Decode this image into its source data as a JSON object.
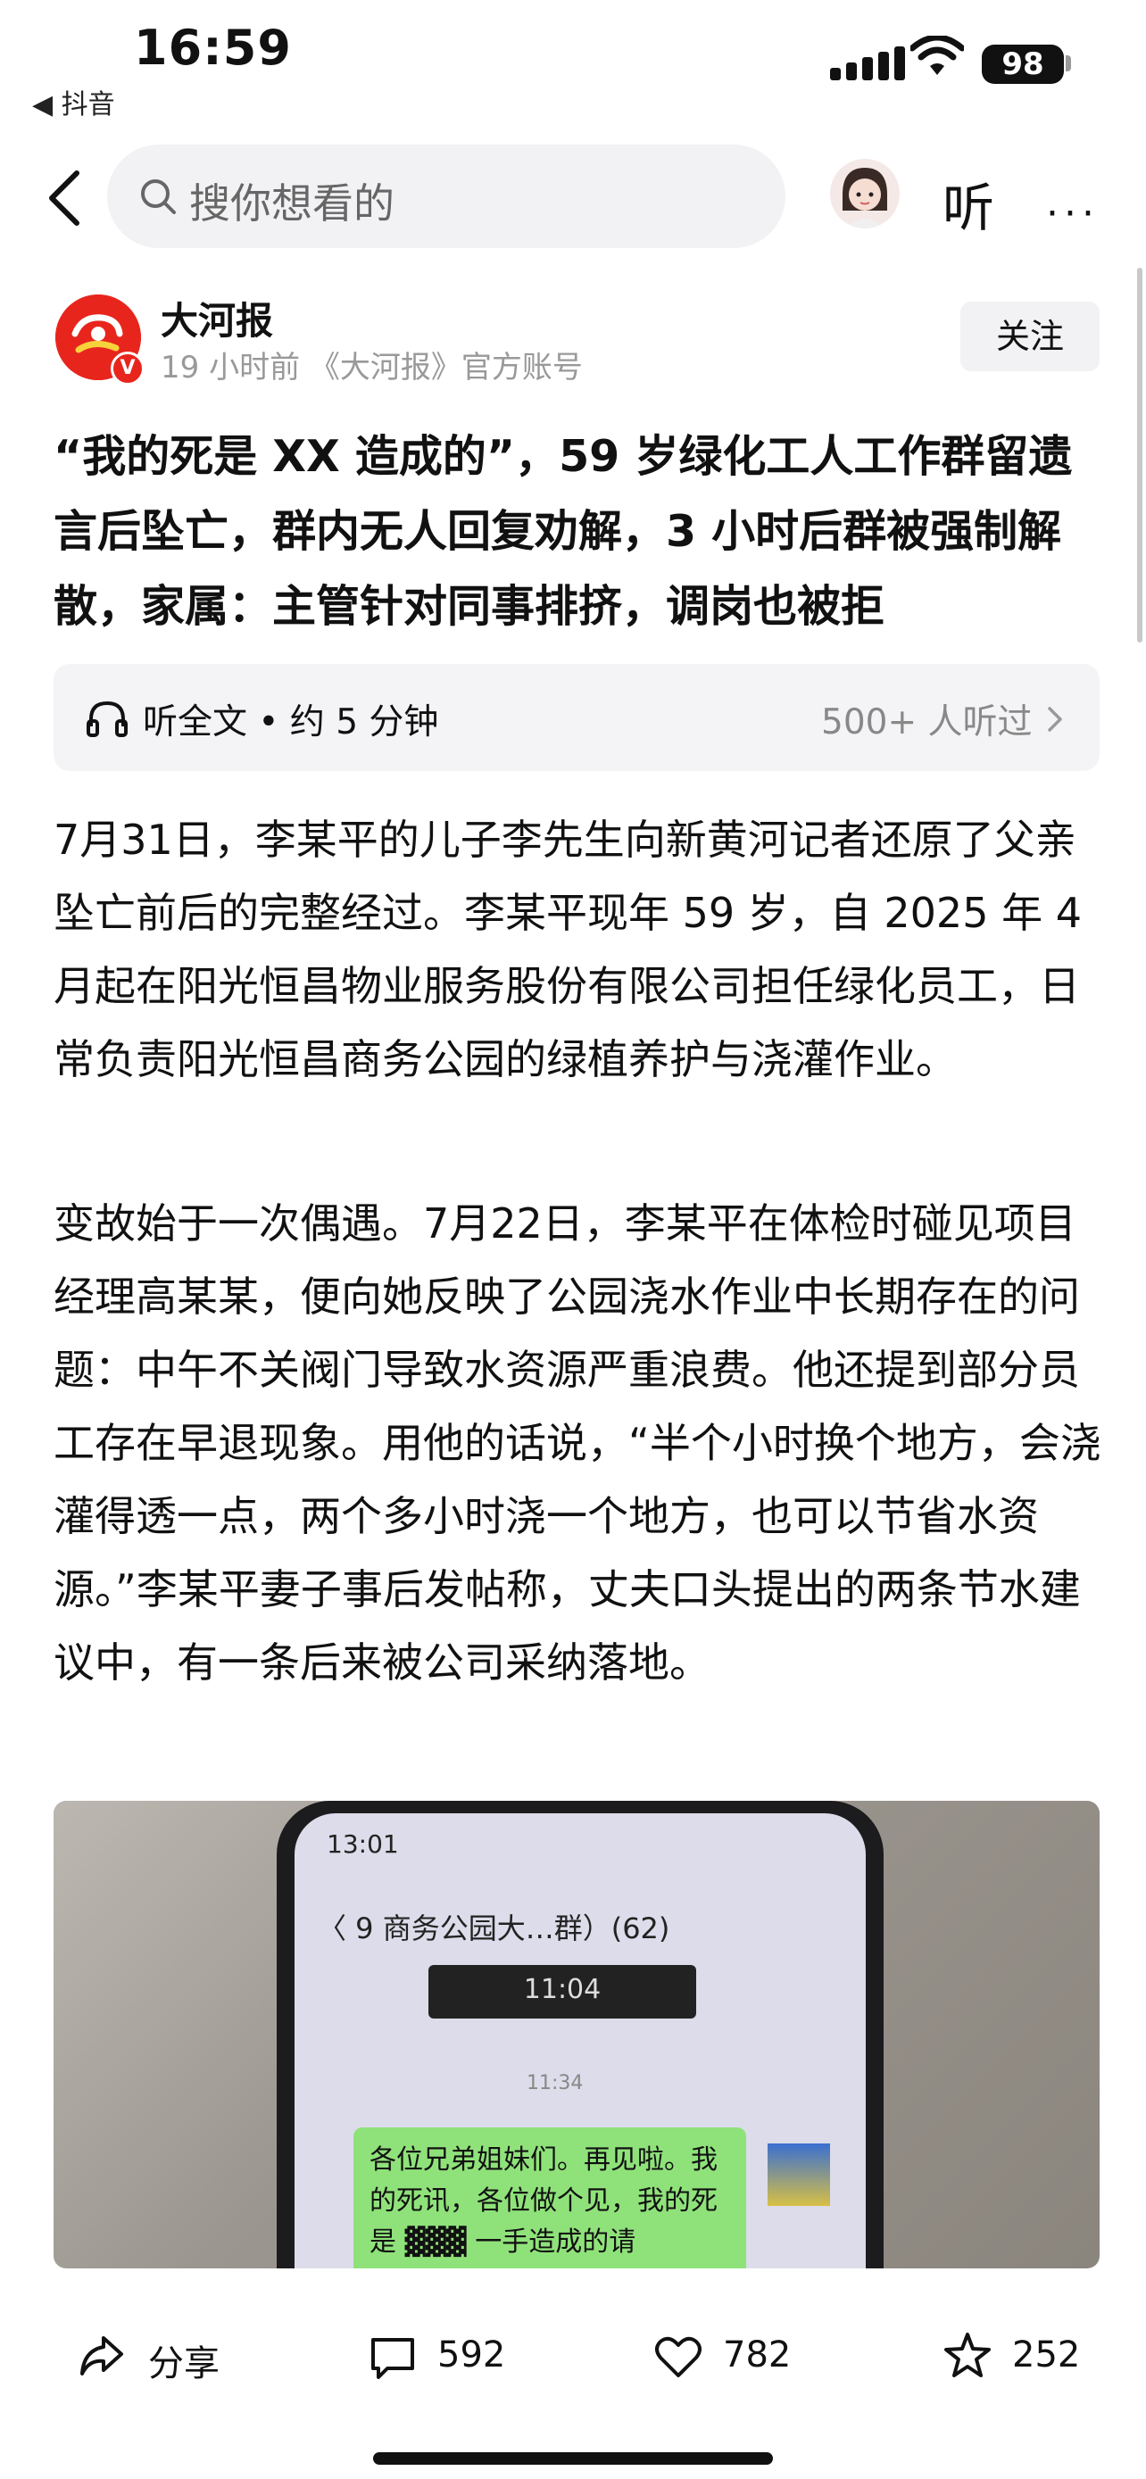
{
  "status_bar": {
    "time": "16:59",
    "back_app": "◀ 抖音",
    "battery": "98"
  },
  "nav": {
    "search_placeholder": "搜你想看的",
    "listen_label": "听",
    "more_label": "···"
  },
  "author": {
    "name": "大河报",
    "meta": "19 小时前 《大河报》官方账号",
    "follow_label": "关注",
    "badge": "V"
  },
  "article": {
    "title": "“我的死是 XX 造成的”，59 岁绿化工人工作群留遗言后坠亡，群内无人回复劝解，3 小时后群被强制解散，家属：主管针对同事排挤，调岗也被拒",
    "listen_full": "听全文 • 约 5 分钟",
    "listeners": "500+ 人听过",
    "paragraph1": "7月31日，李某平的儿子李先生向新黄河记者还原了父亲坠亡前后的完整经过。李某平现年 59 岁，自 2025 年 4 月起在阳光恒昌物业服务股份有限公司担任绿化员工，日常负责阳光恒昌商务公园的绿植养护与浇灌作业。",
    "paragraph2": "变故始于一次偶遇。7月22日，李某平在体检时碰见项目经理高某某，便向她反映了公园浇水作业中长期存在的问题：中午不关阀门导致水资源严重浪费。他还提到部分员工存在早退现象。用他的话说，“半个小时换个地方，会浇灌得透一点，两个多小时浇一个地方，也可以节省水资源。”李某平妻子事后发帖称，丈夫口头提出的两条节水建议中，有一条后来被公司采纳落地。"
  },
  "photo": {
    "phone_status": "13:01",
    "chat_title": "〈 9   商务公园大…群）(62)",
    "time_box": "11:04",
    "timestamp": "11:34",
    "bubble_text": "各位兄弟姐妹们。再见啦。我的死讯，各位做个见，我的死是 ▓▓▓ 一手造成的请"
  },
  "actions": {
    "share": "分享",
    "comments": "592",
    "likes": "782",
    "favorites": "252"
  }
}
